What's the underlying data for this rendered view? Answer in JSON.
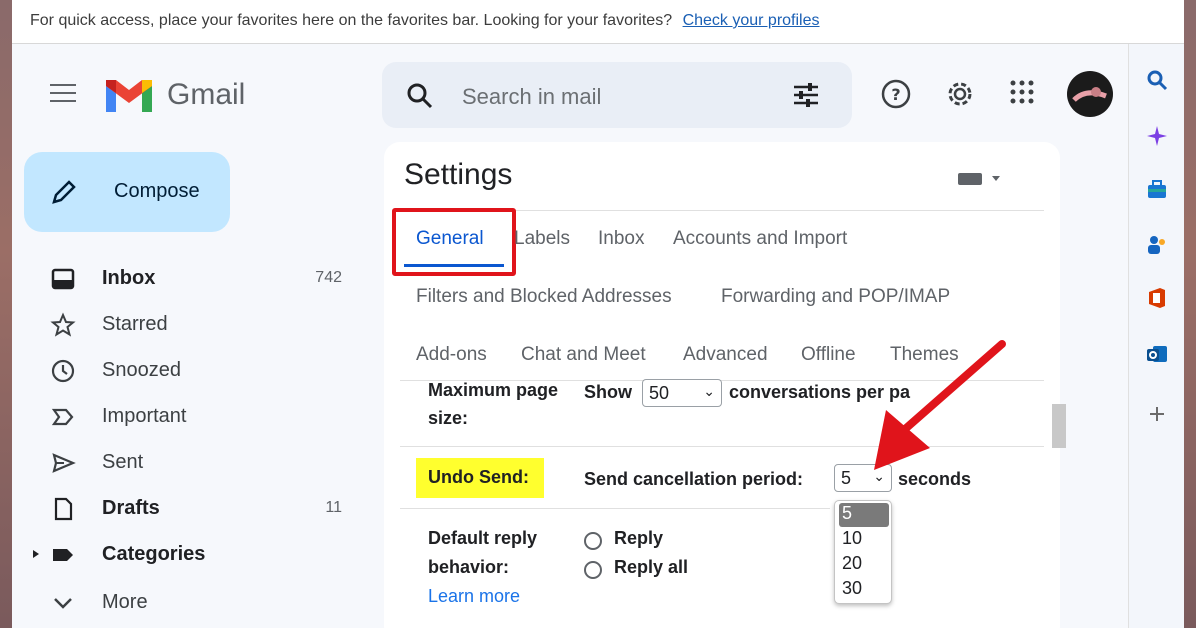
{
  "favorites_bar": {
    "message": "For quick access, place your favorites here on the favorites bar. Looking for your favorites?",
    "link": "Check your profiles"
  },
  "header": {
    "app_name": "Gmail",
    "search_placeholder": "Search in mail",
    "icons": [
      "menu-icon",
      "search-icon",
      "search-options-icon",
      "help-icon",
      "settings-icon",
      "apps-grid-icon",
      "avatar"
    ]
  },
  "sidebar": {
    "compose": "Compose",
    "items": [
      {
        "label": "Inbox",
        "count": "742",
        "bold": true,
        "icon": "inbox-icon"
      },
      {
        "label": "Starred",
        "count": "",
        "bold": false,
        "icon": "star-icon"
      },
      {
        "label": "Snoozed",
        "count": "",
        "bold": false,
        "icon": "clock-icon"
      },
      {
        "label": "Important",
        "count": "",
        "bold": false,
        "icon": "important-icon"
      },
      {
        "label": "Sent",
        "count": "",
        "bold": false,
        "icon": "send-icon"
      },
      {
        "label": "Drafts",
        "count": "11",
        "bold": true,
        "icon": "draft-icon"
      },
      {
        "label": "Categories",
        "count": "",
        "bold": true,
        "icon": "label-icon"
      },
      {
        "label": "More",
        "count": "",
        "bold": false,
        "icon": "chevron-down-icon"
      }
    ]
  },
  "settings": {
    "title": "Settings",
    "tabs_row1": [
      "General",
      "Labels",
      "Inbox",
      "Accounts and Import"
    ],
    "tabs_row2": [
      "Filters and Blocked Addresses",
      "Forwarding and POP/IMAP"
    ],
    "tabs_row3": [
      "Add-ons",
      "Chat and Meet",
      "Advanced",
      "Offline",
      "Themes"
    ],
    "active_tab": "General",
    "max_page_size": {
      "label_line1": "Maximum page",
      "label_line2": "size:",
      "show": "Show",
      "value": "50",
      "suffix": "conversations per pa"
    },
    "undo_send": {
      "label": "Undo Send:",
      "period_label": "Send cancellation period:",
      "value": "5",
      "suffix": "seconds",
      "options": [
        "5",
        "10",
        "20",
        "30"
      ],
      "selected": "5"
    },
    "default_reply": {
      "label_line1": "Default reply",
      "label_line2": "behavior:",
      "options": [
        "Reply",
        "Reply all"
      ],
      "learn_more": "Learn more"
    }
  },
  "colors": {
    "highlight": "#ffff2e",
    "annotation_red": "#e0141b",
    "compose_bg": "#c2e7ff",
    "active_tab": "#0b57d0"
  },
  "right_rail": [
    "search-icon",
    "copilot-icon",
    "briefcase-icon",
    "people-icon",
    "office-icon",
    "outlook-icon",
    "add-icon"
  ]
}
